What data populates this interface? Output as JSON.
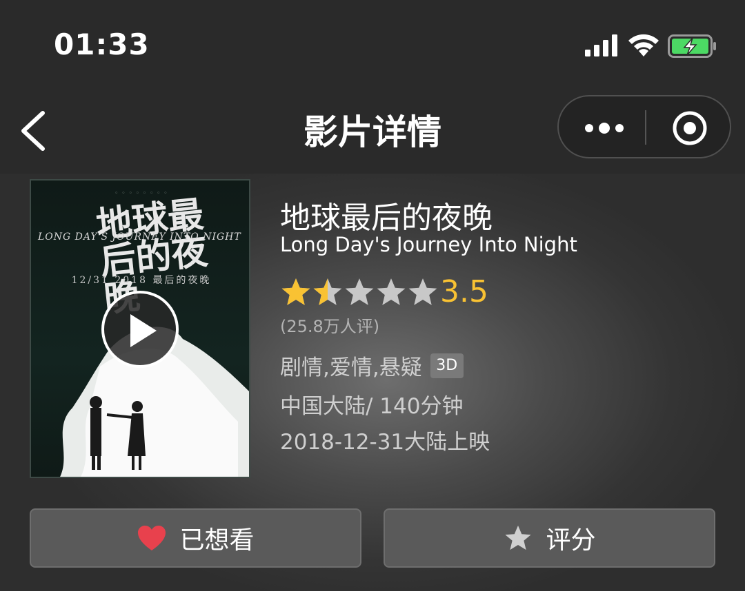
{
  "status_bar": {
    "time": "01:33",
    "signal_icon": "cellular-signal-icon",
    "wifi_icon": "wifi-icon",
    "battery_icon": "battery-charging-icon",
    "battery_color": "#4cd964"
  },
  "nav": {
    "title": "影片详情",
    "back_icon": "chevron-left-icon",
    "more_icon": "more-dots-icon",
    "close_icon": "target-circle-icon"
  },
  "poster": {
    "title_cn": "地球最后的夜晚",
    "title_en": "LONG DAY'S JOURNEY INTO NIGHT",
    "date_line": "12/31 2018 最后的夜晚",
    "play_icon": "play-icon"
  },
  "movie": {
    "title_cn": "地球最后的夜晚",
    "title_en": "Long Day's Journey Into Night",
    "rating": {
      "score": "3.5",
      "stars_filled": 1.5,
      "stars_total": 5,
      "count_text": "(25.8万人评)",
      "star_color": "#f9c233",
      "empty_star_color": "#c8c8c8"
    },
    "genres": "剧情,爱情,悬疑",
    "format_badge": "3D",
    "region_duration": "中国大陆/ 140分钟",
    "release": "2018-12-31大陆上映"
  },
  "actions": {
    "want_label": "已想看",
    "want_icon": "heart-icon",
    "want_icon_color": "#e8414d",
    "rate_label": "评分",
    "rate_icon": "star-icon"
  }
}
